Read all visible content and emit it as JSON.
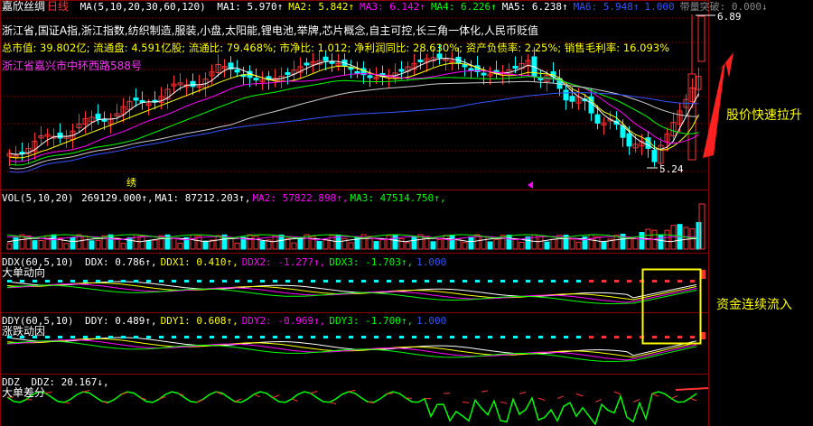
{
  "stock": {
    "name": "嘉欣丝绸",
    "period": "日线",
    "name_color": "#ffffff",
    "period_color": "#ff3333"
  },
  "ma": {
    "params": "MA(5,10,20,30,60,120)",
    "items": [
      {
        "label": "MA1: 5.970↑",
        "color": "#ffffff"
      },
      {
        "label": "MA2: 5.842↑",
        "color": "#ffff00"
      },
      {
        "label": "MA3: 6.142↑",
        "color": "#ff00ff"
      },
      {
        "label": "MA4: 6.226↑",
        "color": "#00ff00"
      },
      {
        "label": "MA5: 6.238↑",
        "color": "#ffffff"
      },
      {
        "label": "MA6: 5.948↑",
        "color": "#3355ff"
      },
      {
        "label": "1.000",
        "color": "#3355ff"
      },
      {
        "label": "带量突破: 0.000↓",
        "color": "#888888"
      }
    ]
  },
  "info": {
    "concepts": "浙江省,国证A指,浙江指数,纺织制造,服装,小盘,太阳能,锂电池,举牌,芯片概念,自主可控,长三角一体化,人民币贬值",
    "stats": "总市值: 39.802亿; 流通盘: 4.591亿股; 流通比: 79.468%; 市净比: 1.012; 净利润同比: 28.630%; 资产负债率: 2.25%; 销售毛利率: 16.093%",
    "address": "浙江省嘉兴市中环西路588号"
  },
  "price_labels": {
    "high": "6.89",
    "low": "5.24",
    "marker": "绣"
  },
  "annotations": {
    "price": "股价快速拉升",
    "fund": "资金连续流入"
  },
  "vol": {
    "params": "VOL(5,10,20)",
    "items": [
      {
        "label": "269129.000↑,",
        "color": "#ffffff"
      },
      {
        "label": "MA1: 87212.203↑,",
        "color": "#ffffff"
      },
      {
        "label": "MA2: 57822.898↑,",
        "color": "#ff00ff"
      },
      {
        "label": "MA3: 47514.750↑,",
        "color": "#00ff00"
      }
    ]
  },
  "ddx": {
    "params": "DDX(60,5,10)",
    "name": "大单动向",
    "items": [
      {
        "label": "DDX: 0.786↑,",
        "color": "#ffffff"
      },
      {
        "label": "DDX1: 0.410↑,",
        "color": "#ffff00"
      },
      {
        "label": "DDX2: -1.277↑,",
        "color": "#ff00ff"
      },
      {
        "label": "DDX3: -1.703↑,",
        "color": "#00ff00"
      },
      {
        "label": "1.000",
        "color": "#3355ff"
      }
    ]
  },
  "ddy": {
    "params": "DDY(60,5,10)",
    "name": "涨跌动因",
    "items": [
      {
        "label": "DDY: 0.489↑,",
        "color": "#ffffff"
      },
      {
        "label": "DDY1: 0.608↑,",
        "color": "#ffff00"
      },
      {
        "label": "DDY2: -0.969↑,",
        "color": "#ff00ff"
      },
      {
        "label": "DDY3: -1.700↑,",
        "color": "#00ff00"
      },
      {
        "label": "1.000",
        "color": "#3355ff"
      }
    ]
  },
  "ddz": {
    "params": "DDZ",
    "name": "大单差分",
    "items": [
      {
        "label": "DDZ: 20.167↓,",
        "color": "#ffffff"
      }
    ]
  },
  "colors": {
    "up": "#ff3333",
    "down": "#00ffff",
    "grid": "#8b0000",
    "highlight": "#ffff00"
  }
}
